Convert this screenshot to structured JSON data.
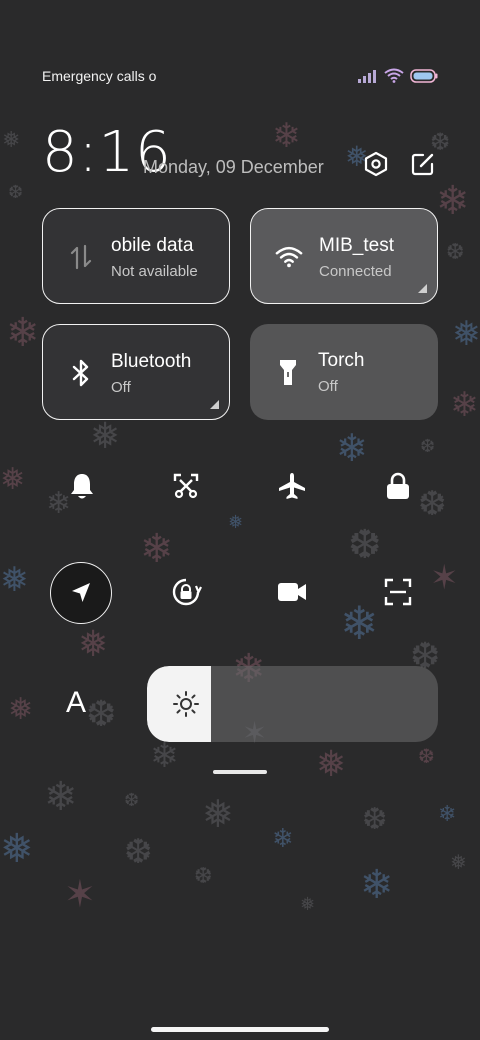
{
  "status_bar": {
    "carrier_text": "Emergency calls o",
    "signal_icon": "signal-bars-icon",
    "wifi_icon": "wifi-icon",
    "battery_icon": "battery-icon"
  },
  "header": {
    "time": "8:16",
    "date": "Monday, 09 December",
    "settings_icon": "settings-hexagon-icon",
    "edit_icon": "edit-icon"
  },
  "tiles": [
    {
      "label": "obile data",
      "sub": "Not available",
      "icon": "mobile-data-arrows-icon",
      "state": "unavailable"
    },
    {
      "label": "MIB_test",
      "sub": "Connected",
      "icon": "wifi-icon",
      "state": "active"
    },
    {
      "label": "Bluetooth",
      "sub": "Off",
      "icon": "bluetooth-icon",
      "state": "off"
    },
    {
      "label": "Torch",
      "sub": "Off",
      "icon": "torch-icon",
      "state": "off"
    }
  ],
  "quick_buttons_row1": [
    "bell-icon",
    "screenshot-scissors-icon",
    "airplane-icon",
    "lock-icon"
  ],
  "quick_buttons_row2": [
    "location-arrow-icon",
    "rotation-lock-icon",
    "video-camera-icon",
    "scan-icon"
  ],
  "brightness": {
    "auto_label": "A",
    "level": 0.22,
    "icon": "sun-icon"
  },
  "colors": {
    "background": "#2a2a2b",
    "tile_outline": "#f2f2f2",
    "slider_fill": "#f3f3f3"
  }
}
